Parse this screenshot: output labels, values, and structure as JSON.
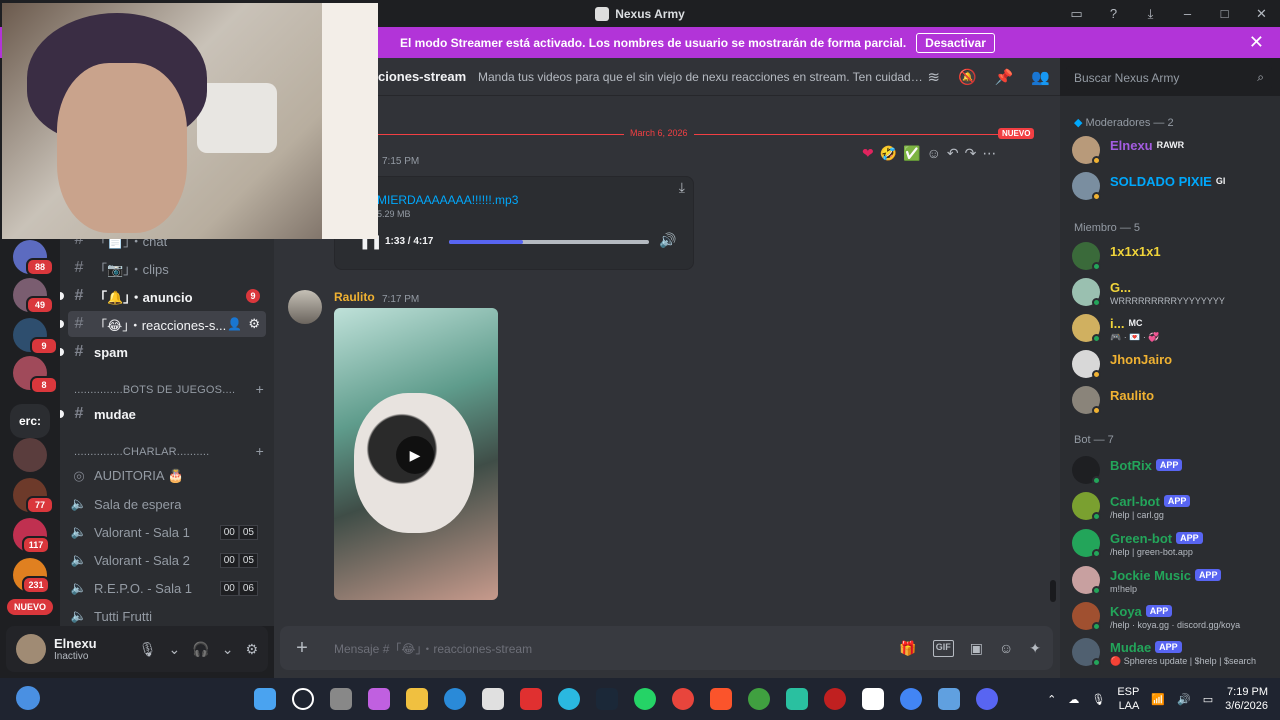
{
  "app": {
    "title": "Nexus Army"
  },
  "banner": {
    "text": "El modo Streamer está activado. Los nombres de usuario se mostrarán de forma parcial.",
    "button": "Desactivar"
  },
  "guilds": {
    "badges": [
      "88",
      "49",
      "9",
      "8",
      "77",
      "117",
      "231"
    ],
    "text_server": "erc:",
    "new_pill": "NUEVO"
  },
  "channels": {
    "items": [
      {
        "name": "「📄」・chat"
      },
      {
        "name": "「📷」・clips"
      },
      {
        "name": "「🔔」・anuncio",
        "mentions": "9"
      },
      {
        "name": "「😂」・reacciones-s..."
      },
      {
        "name": "spam"
      }
    ],
    "cat_bots": "...............BOTS DE JUEGOS....",
    "mudae": "mudae",
    "cat_charlar": "...............CHARLAR..........",
    "voice": [
      {
        "name": "AUDITORIA 🎂"
      },
      {
        "name": "Sala de espera"
      },
      {
        "name": "Valorant - Sala 1",
        "c1": "00",
        "c2": "05"
      },
      {
        "name": "Valorant - Sala 2",
        "c1": "00",
        "c2": "05"
      },
      {
        "name": "R.E.P.O. - Sala 1",
        "c1": "00",
        "c2": "06"
      },
      {
        "name": "Tutti Frutti"
      }
    ]
  },
  "user": {
    "name": "Elnexu",
    "status": "Inactivo"
  },
  "header": {
    "channel": "ciones-stream",
    "topic": "Manda tus videos para que el sin viejo de nexu reacciones en stream. Ten cuidado con l..."
  },
  "search": {
    "placeholder": "Buscar Nexus Army"
  },
  "messages": {
    "divider_date": "March 6, 2026",
    "new_label": "NUEVO",
    "first_time": "7:15 PM",
    "audio": {
      "file": "MIERDAAAAAAA!!!!!!.mp3",
      "size": "5.29 MB",
      "time": "1:33 / 4:17",
      "progress": 0.37
    },
    "second_author": "Raulito",
    "second_time": "7:17 PM"
  },
  "composer": {
    "placeholder": "Mensaje #「😂」・reacciones-stream"
  },
  "members": {
    "mods_header": "Moderadores — 2",
    "members_header": "Miembro — 5",
    "bots_header": "Bot — 7",
    "mods": [
      {
        "name": "Elnexu",
        "tag": "RAWR",
        "color": "#a35ce0"
      },
      {
        "name": "SOLDADO PIXIE",
        "tag": "GI",
        "color": "#00a8fc"
      }
    ],
    "members": [
      {
        "name": "1x1x1x1",
        "color": "#f0d43a",
        "sub": ""
      },
      {
        "name": "G...",
        "color": "#f0d43a",
        "sub": "WRRRRRRRRRYYYYYYYY"
      },
      {
        "name": "i...",
        "color": "#f0d43a",
        "tag": "MC",
        "sub": "🎮 · 💌 · 💞"
      },
      {
        "name": "JhonJairo",
        "color": "#f0b232",
        "sub": ""
      },
      {
        "name": "Raulito",
        "color": "#f0b232",
        "sub": ""
      }
    ],
    "bots": [
      {
        "name": "BotRix",
        "color": "#23a55a",
        "tag": "APP",
        "sub": ""
      },
      {
        "name": "Carl-bot",
        "color": "#23a55a",
        "tag": "APP",
        "sub": "/help | carl.gg"
      },
      {
        "name": "Green-bot",
        "color": "#23a55a",
        "tag": "APP",
        "sub": "/help | green-bot.app"
      },
      {
        "name": "Jockie Music",
        "color": "#23a55a",
        "tag": "APP",
        "sub": "m!help"
      },
      {
        "name": "Koya",
        "color": "#23a55a",
        "tag": "APP",
        "sub": "/help · koya.gg · discord.gg/koya"
      },
      {
        "name": "Mudae",
        "color": "#23a55a",
        "tag": "APP",
        "sub": "🔴 Spheres update | $help | $search"
      }
    ]
  },
  "taskbar": {
    "lang1": "ESP",
    "lang2": "LAA",
    "time": "7:19 PM",
    "date": "3/6/2026"
  }
}
